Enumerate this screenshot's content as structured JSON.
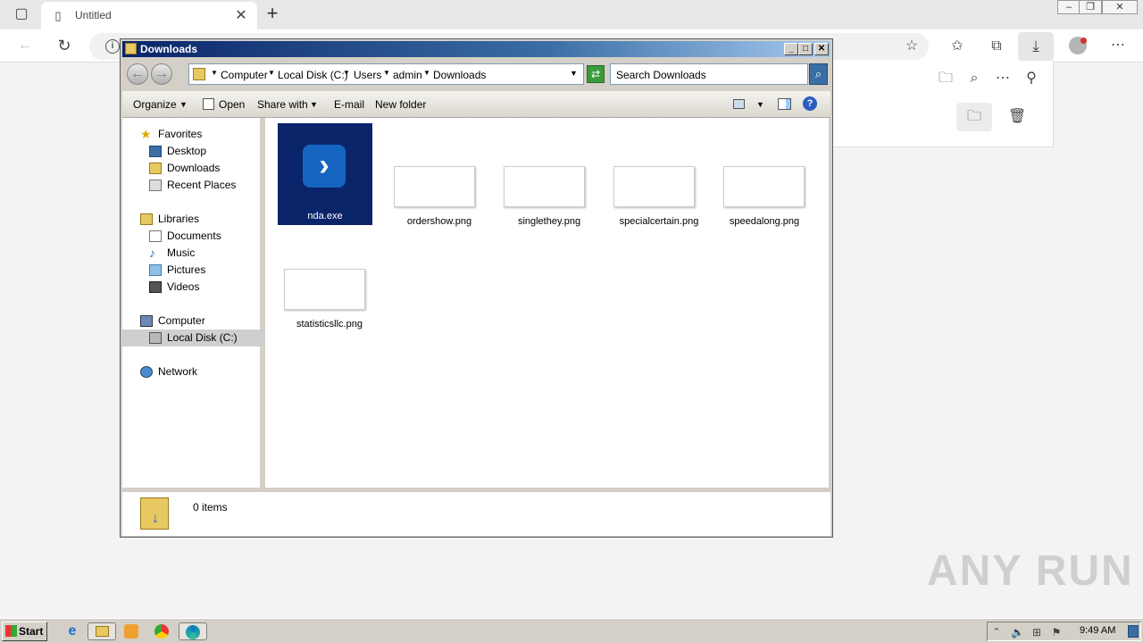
{
  "browser": {
    "tab_title": "Untitled",
    "new_tab": "+",
    "info_icon": "i",
    "colors": {
      "download_badge": "#d32f2f"
    }
  },
  "explorer": {
    "title": "Downloads",
    "breadcrumbs": [
      "Computer",
      "Local Disk (C:)",
      "Users",
      "admin",
      "Downloads"
    ],
    "search_placeholder": "Search Downloads",
    "commands": {
      "organize": "Organize",
      "open": "Open",
      "share_with": "Share with",
      "email": "E-mail",
      "new_folder": "New folder"
    },
    "nav": {
      "favorites": "Favorites",
      "favorites_items": [
        "Desktop",
        "Downloads",
        "Recent Places"
      ],
      "libraries": "Libraries",
      "libraries_items": [
        "Documents",
        "Music",
        "Pictures",
        "Videos"
      ],
      "computer": "Computer",
      "computer_items": [
        "Local Disk (C:)"
      ],
      "network": "Network"
    },
    "files": [
      "nda.exe",
      "ordershow.png",
      "singlethey.png",
      "specialcertain.png",
      "speedalong.png",
      "statisticsllc.png"
    ],
    "status": "0 items"
  },
  "taskbar": {
    "start": "Start",
    "clock": "9:49 AM"
  },
  "watermark": "ANY RUN"
}
